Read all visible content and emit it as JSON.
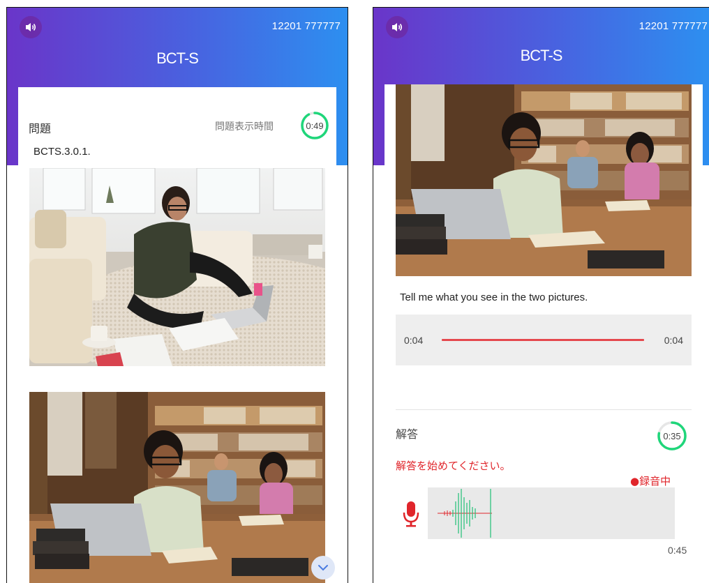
{
  "left_screen": {
    "header": {
      "speaker_icon": "speaker-icon",
      "phone_number": "12201 777777",
      "title": "BCT-S"
    },
    "question_label": "問題",
    "display_time_label": "問題表示時間",
    "timer": {
      "text": "0:49",
      "progress": 0.92
    },
    "question_id": "BCTS.3.0.1.",
    "images": [
      "photo-woman-studying-on-rug",
      "photo-students-in-library"
    ],
    "scroll_button_icon": "chevron-down-icon"
  },
  "right_screen": {
    "header": {
      "speaker_icon": "speaker-icon",
      "phone_number": "12201 777777",
      "title": "BCT-S"
    },
    "image": "photo-students-in-library",
    "prompt_text": "Tell me what you see in the two pictures.",
    "audio_player": {
      "current": "0:04",
      "total": "0:04",
      "progress": 1.0
    },
    "answer_label": "解答",
    "answer_timer": {
      "text": "0:35",
      "progress": 0.78
    },
    "instruction": "解答を始めてください。",
    "recording_status": "●録音中",
    "record_time": "0:45",
    "mic_icon": "microphone-icon"
  },
  "colors": {
    "header_start": "#6a35c9",
    "header_end": "#2d8ff0",
    "timer_green": "#1fd67a",
    "red": "#e0252b",
    "waveform": "#2ec27e"
  }
}
